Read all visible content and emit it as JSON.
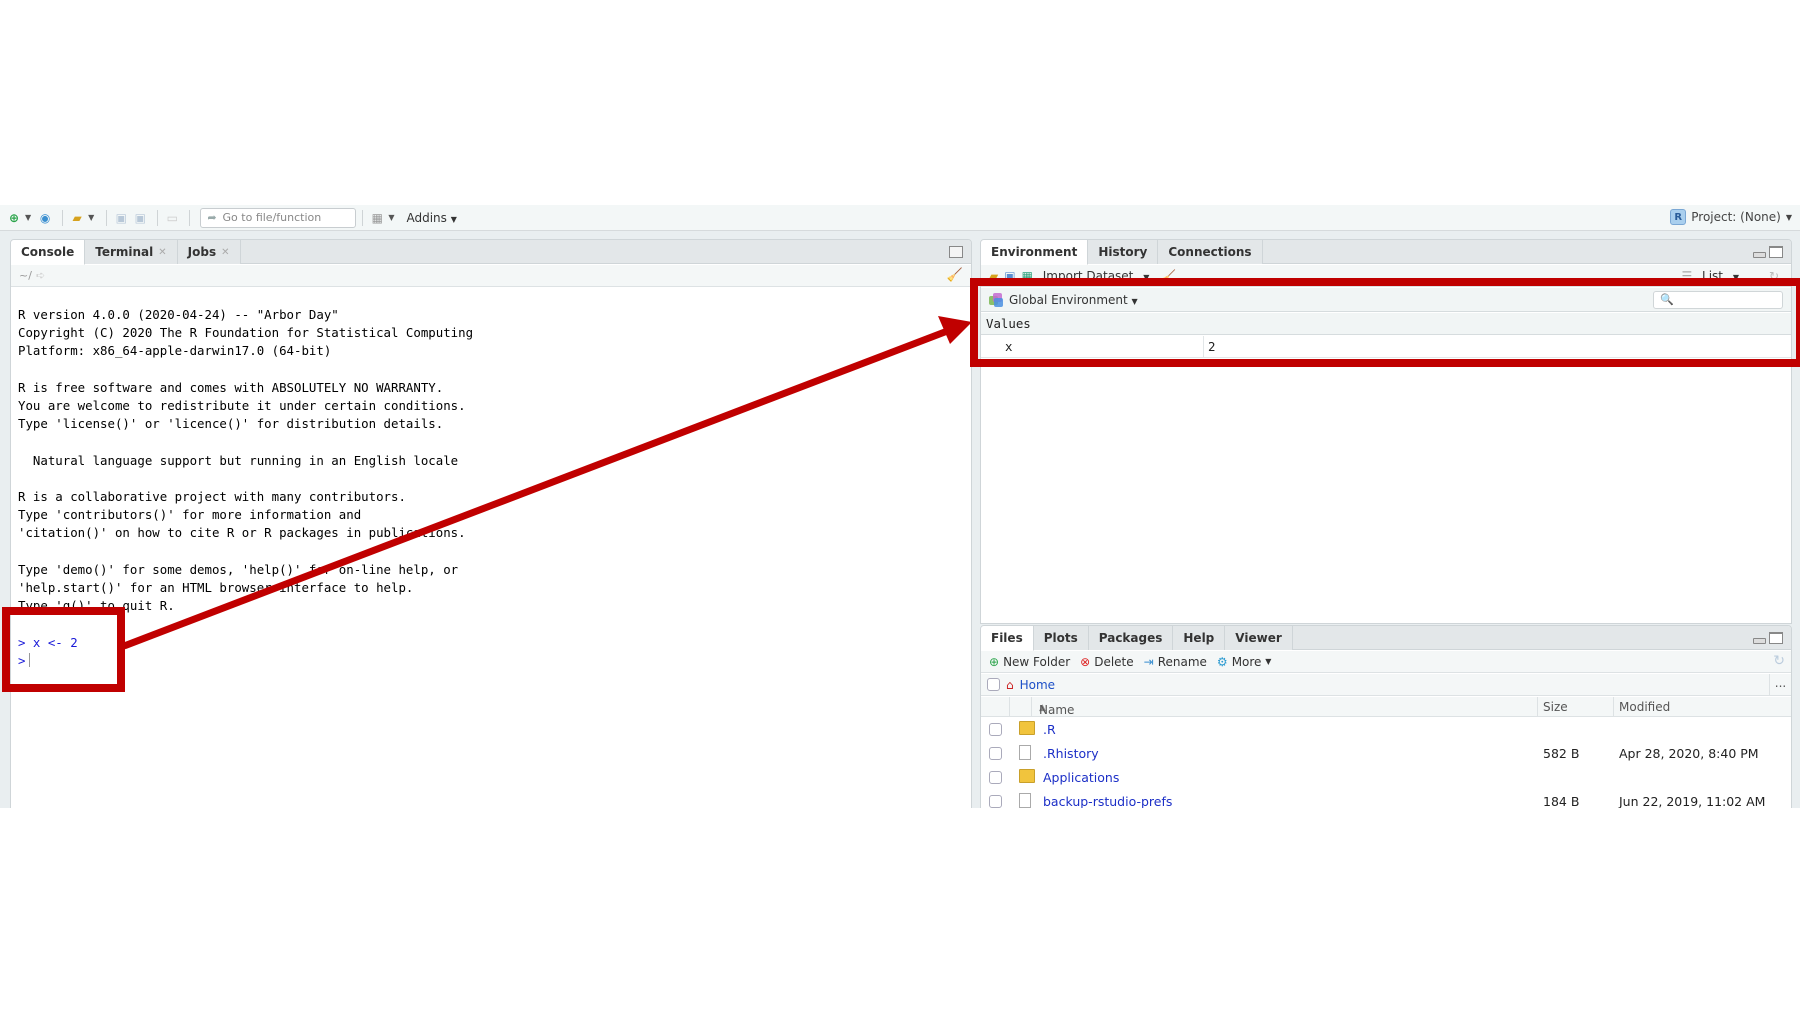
{
  "toolbar": {
    "goto_placeholder": "Go to file/function",
    "addins_label": "Addins",
    "project_label": "Project: (None)",
    "r_badge": "R"
  },
  "console_pane": {
    "tabs": [
      {
        "label": "Console",
        "active": true,
        "closable": false
      },
      {
        "label": "Terminal",
        "active": false,
        "closable": true
      },
      {
        "label": "Jobs",
        "active": false,
        "closable": true
      }
    ],
    "path": "~/",
    "output_lines": [
      "R version 4.0.0 (2020-04-24) -- \"Arbor Day\"",
      "Copyright (C) 2020 The R Foundation for Statistical Computing",
      "Platform: x86_64-apple-darwin17.0 (64-bit)",
      "",
      "R is free software and comes with ABSOLUTELY NO WARRANTY.",
      "You are welcome to redistribute it under certain conditions.",
      "Type 'license()' or 'licence()' for distribution details.",
      "",
      "  Natural language support but running in an English locale",
      "",
      "R is a collaborative project with many contributors.",
      "Type 'contributors()' for more information and",
      "'citation()' on how to cite R or R packages in publications.",
      "",
      "Type 'demo()' for some demos, 'help()' for on-line help, or",
      "'help.start()' for an HTML browser interface to help.",
      "Type 'q()' to quit R.",
      ""
    ],
    "input_line": "> x <- 2",
    "prompt": ">"
  },
  "env_pane": {
    "tabs": [
      {
        "label": "Environment",
        "active": true
      },
      {
        "label": "History",
        "active": false
      },
      {
        "label": "Connections",
        "active": false
      }
    ],
    "import_label": "Import Dataset",
    "view_mode": "List",
    "scope_label": "Global Environment",
    "search_placeholder": "",
    "section_label": "Values",
    "variables": [
      {
        "name": "x",
        "value": "2"
      }
    ]
  },
  "files_pane": {
    "tabs": [
      {
        "label": "Files",
        "active": true
      },
      {
        "label": "Plots",
        "active": false
      },
      {
        "label": "Packages",
        "active": false
      },
      {
        "label": "Help",
        "active": false
      },
      {
        "label": "Viewer",
        "active": false
      }
    ],
    "actions": {
      "new_folder": "New Folder",
      "delete": "Delete",
      "rename": "Rename",
      "more": "More"
    },
    "breadcrumb": "Home",
    "more_dots": "...",
    "columns": {
      "name": "Name",
      "size": "Size",
      "modified": "Modified",
      "sort_indicator": "▲"
    },
    "rows": [
      {
        "name": ".R",
        "type": "folder",
        "size": "",
        "modified": ""
      },
      {
        "name": ".Rhistory",
        "type": "rhistory",
        "size": "582 B",
        "modified": "Apr 28, 2020, 8:40 PM"
      },
      {
        "name": "Applications",
        "type": "folder",
        "size": "",
        "modified": ""
      },
      {
        "name": "backup-rstudio-prefs",
        "type": "file",
        "size": "184 B",
        "modified": "Jun 22, 2019, 11:02 AM"
      }
    ]
  },
  "annotation": {
    "color": "#c00000"
  }
}
